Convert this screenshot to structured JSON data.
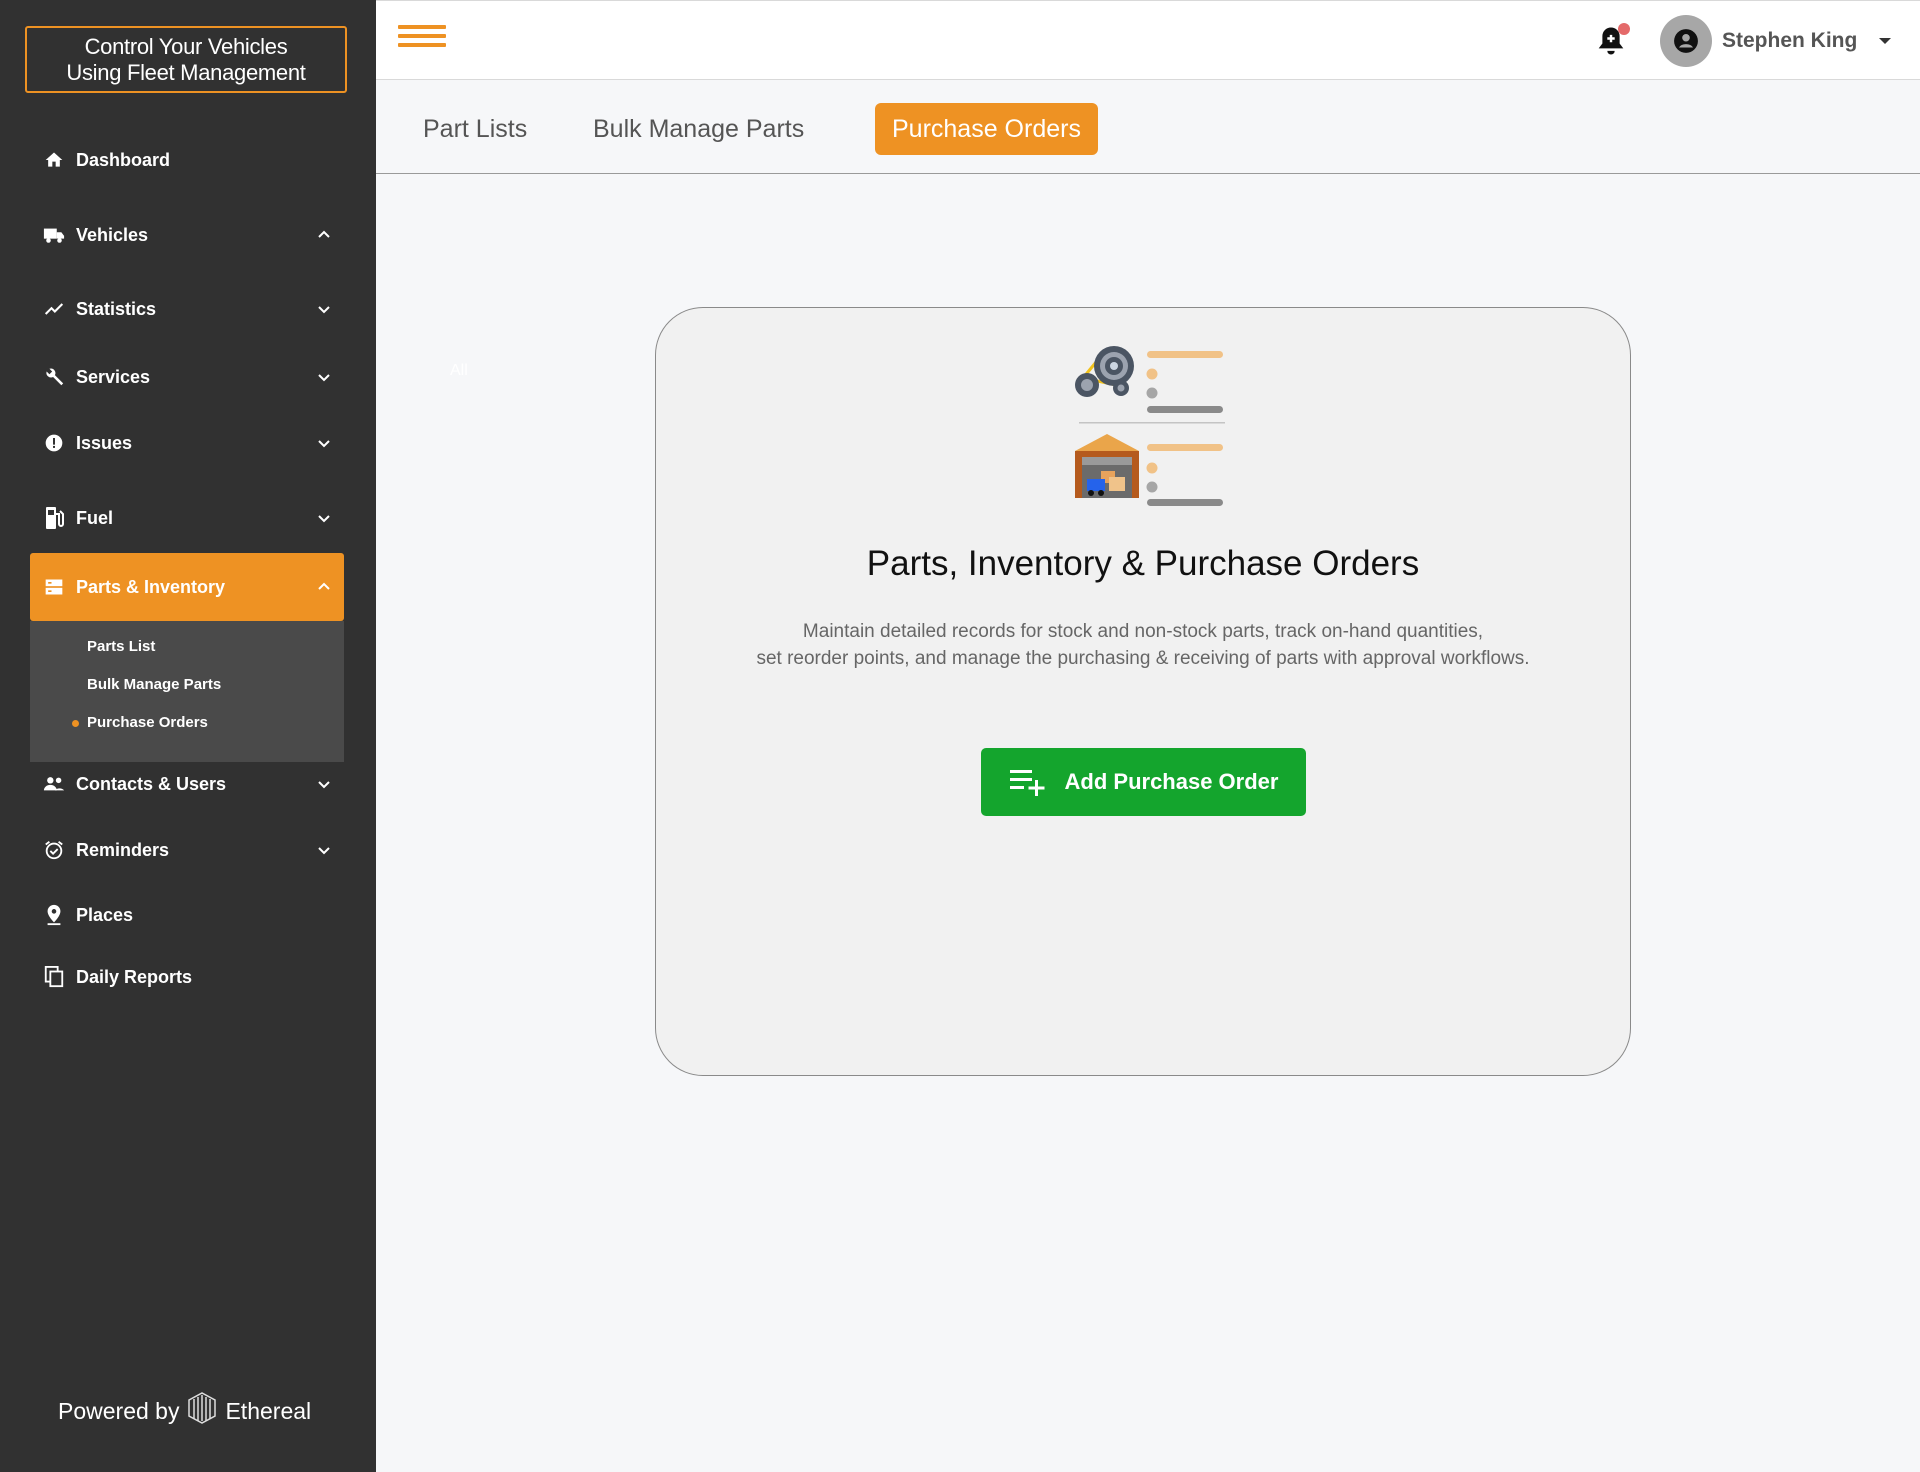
{
  "brand": {
    "line1": "Control Your Vehicles",
    "line2": "Using Fleet Management"
  },
  "sidebar": {
    "items": [
      {
        "label": "Dashboard",
        "icon": "home-icon"
      },
      {
        "label": "Vehicles",
        "icon": "truck-icon",
        "expanded": true
      },
      {
        "label": "Statistics",
        "icon": "trend-icon"
      },
      {
        "label": "Services",
        "icon": "wrench-icon"
      },
      {
        "label": "Issues",
        "icon": "alert-icon"
      },
      {
        "label": "Fuel",
        "icon": "fuel-icon"
      },
      {
        "label": "Parts & Inventory",
        "icon": "inventory-icon",
        "active": true
      },
      {
        "label": "Contacts & Users",
        "icon": "users-icon"
      },
      {
        "label": "Reminders",
        "icon": "alarm-icon"
      },
      {
        "label": "Places",
        "icon": "pin-icon"
      },
      {
        "label": "Daily Reports",
        "icon": "copy-icon"
      }
    ],
    "submenu": [
      "Parts List",
      "Bulk Manage Parts",
      "Purchase Orders"
    ],
    "active_submenu": "Purchase Orders",
    "powered_by": "Powered by",
    "powered_brand": "Ethereal"
  },
  "header": {
    "user_name": "Stephen King"
  },
  "tabs": [
    "Part Lists",
    "Bulk Manage Parts",
    "Purchase Orders"
  ],
  "active_tab": "Purchase Orders",
  "faint_text": "All",
  "card": {
    "title": "Parts, Inventory & Purchase Orders",
    "desc_line1": "Maintain detailed records for stock and non-stock parts, track on-hand quantities,",
    "desc_line2": "set reorder points, and manage the purchasing & receiving of parts with approval workflows.",
    "button": "Add Purchase Order"
  },
  "colors": {
    "accent": "#ee9223",
    "sidebar": "#313131",
    "success": "#14a52d"
  }
}
